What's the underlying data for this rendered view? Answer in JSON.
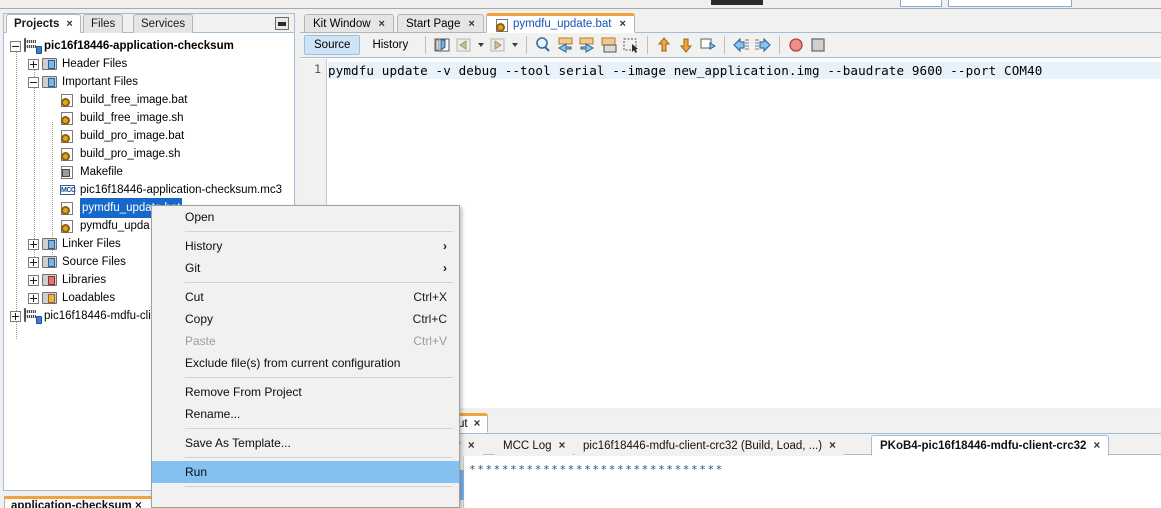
{
  "explorer": {
    "tabs": [
      {
        "label": "Projects",
        "closable": true,
        "active": true
      },
      {
        "label": "Files",
        "closable": false,
        "active": false
      },
      {
        "label": "Services",
        "closable": false,
        "active": false
      }
    ],
    "close_glyph": "×",
    "minimize_name": "minimize-button",
    "tree": [
      {
        "label": "pic16f18446-application-checksum",
        "icon": "project-icon",
        "indent": 0,
        "expander": "minus",
        "bold": true,
        "selected": false
      },
      {
        "label": "Header Files",
        "icon": "folder-blue-icon",
        "indent": 1,
        "expander": "plus",
        "bold": false,
        "selected": false
      },
      {
        "label": "Important Files",
        "icon": "folder-blue-icon",
        "indent": 1,
        "expander": "minus",
        "bold": false,
        "selected": false
      },
      {
        "label": "build_free_image.bat",
        "icon": "gear-file-icon",
        "indent": 2,
        "expander": "none",
        "bold": false,
        "selected": false
      },
      {
        "label": "build_free_image.sh",
        "icon": "gear-file-icon",
        "indent": 2,
        "expander": "none",
        "bold": false,
        "selected": false
      },
      {
        "label": "build_pro_image.bat",
        "icon": "gear-file-icon",
        "indent": 2,
        "expander": "none",
        "bold": false,
        "selected": false
      },
      {
        "label": "build_pro_image.sh",
        "icon": "gear-file-icon",
        "indent": 2,
        "expander": "none",
        "bold": false,
        "selected": false
      },
      {
        "label": "Makefile",
        "icon": "makefile-icon",
        "indent": 2,
        "expander": "none",
        "bold": false,
        "selected": false
      },
      {
        "label": "pic16f18446-application-checksum.mc3",
        "icon": "mcc-icon",
        "indent": 2,
        "expander": "none",
        "bold": false,
        "selected": false
      },
      {
        "label": "pymdfu_update.bat",
        "icon": "gear-file-icon",
        "indent": 2,
        "expander": "none",
        "bold": false,
        "selected": true
      },
      {
        "label": "pymdfu_upda",
        "icon": "gear-file-icon",
        "indent": 2,
        "expander": "none",
        "bold": false,
        "selected": false
      },
      {
        "label": "Linker Files",
        "icon": "folder-blue-icon",
        "indent": 1,
        "expander": "plus",
        "bold": false,
        "selected": false
      },
      {
        "label": "Source Files",
        "icon": "folder-blue-icon",
        "indent": 1,
        "expander": "plus",
        "bold": false,
        "selected": false
      },
      {
        "label": "Libraries",
        "icon": "folder-red-icon",
        "indent": 1,
        "expander": "plus",
        "bold": false,
        "selected": false
      },
      {
        "label": "Loadables",
        "icon": "folder-orange-icon",
        "indent": 1,
        "expander": "plus",
        "bold": false,
        "selected": false
      },
      {
        "label": "pic16f18446-mdfu-clie",
        "icon": "project-icon",
        "indent": 0,
        "expander": "plus",
        "bold": false,
        "selected": false
      }
    ]
  },
  "bottom_left_tab": {
    "label": "application-checksum  ×"
  },
  "editor": {
    "tabs": [
      {
        "label": "Kit Window",
        "active": false,
        "icon": "none"
      },
      {
        "label": "Start Page",
        "active": false,
        "icon": "none"
      },
      {
        "label": "pymdfu_update.bat",
        "active": true,
        "icon": "gear-file-icon"
      }
    ],
    "close_glyph": "×",
    "view_buttons": [
      {
        "label": "Source",
        "active": true
      },
      {
        "label": "History",
        "active": false
      }
    ],
    "toolbar_icons": [
      "toggle-bookmark-icon",
      "previous-bookmark-icon",
      "next-bookmark-icon",
      "find-selection-icon",
      "find-previous-icon",
      "find-next-icon",
      "toggle-highlight-icon",
      "last-edit-icon",
      "shift-line-up-icon",
      "shift-line-down-icon",
      "comment-icon",
      "shift-left-icon",
      "shift-right-icon",
      "start-recording-macro-icon",
      "stop-macro-icon"
    ],
    "line_number": "1",
    "code": "pymdfu update -v debug --tool serial --image new_application.img --baudrate 9600 --port COM40"
  },
  "context_menu": {
    "items": [
      {
        "label": "Open",
        "accel": "",
        "submenu": false,
        "disabled": false,
        "highlighted": false,
        "separator_after": true
      },
      {
        "label": "History",
        "accel": "",
        "submenu": true,
        "disabled": false,
        "highlighted": false,
        "separator_after": false
      },
      {
        "label": "Git",
        "accel": "",
        "submenu": true,
        "disabled": false,
        "highlighted": false,
        "separator_after": true
      },
      {
        "label": "Cut",
        "accel": "Ctrl+X",
        "submenu": false,
        "disabled": false,
        "highlighted": false,
        "separator_after": false
      },
      {
        "label": "Copy",
        "accel": "Ctrl+C",
        "submenu": false,
        "disabled": false,
        "highlighted": false,
        "separator_after": false
      },
      {
        "label": "Paste",
        "accel": "Ctrl+V",
        "submenu": false,
        "disabled": true,
        "highlighted": false,
        "separator_after": false
      },
      {
        "label": "Exclude file(s) from current configuration",
        "accel": "",
        "submenu": false,
        "disabled": false,
        "highlighted": false,
        "separator_after": true
      },
      {
        "label": "Remove From Project",
        "accel": "",
        "submenu": false,
        "disabled": false,
        "highlighted": false,
        "separator_after": false
      },
      {
        "label": "Rename...",
        "accel": "",
        "submenu": false,
        "disabled": false,
        "highlighted": false,
        "separator_after": true
      },
      {
        "label": "Save As Template...",
        "accel": "",
        "submenu": false,
        "disabled": false,
        "highlighted": false,
        "separator_after": true
      },
      {
        "label": "Run",
        "accel": "",
        "submenu": false,
        "disabled": false,
        "highlighted": true,
        "separator_after": true
      }
    ],
    "submenu_glyph": "›"
  },
  "bottom_panel": {
    "upper_tabs": [
      {
        "label": "ut",
        "active": true
      }
    ],
    "lower_tabs": [
      {
        "label": "r",
        "active": false
      },
      {
        "label": "MCC Log",
        "active": false
      },
      {
        "label": "pic16f18446-mdfu-client-crc32 (Build, Load, ...)",
        "active": false
      },
      {
        "label": "PKoB4-pic16f18446-mdfu-client-crc32",
        "active": true
      }
    ],
    "close_glyph": "×",
    "output_text": "*******************************"
  },
  "colors": {
    "selection_blue": "#1669c8",
    "menu_highlight": "#84c0f0",
    "tab_accent": "#f0a33c",
    "code_line_bg": "#e8f2fb",
    "panel_bg": "#f1f1f0"
  }
}
